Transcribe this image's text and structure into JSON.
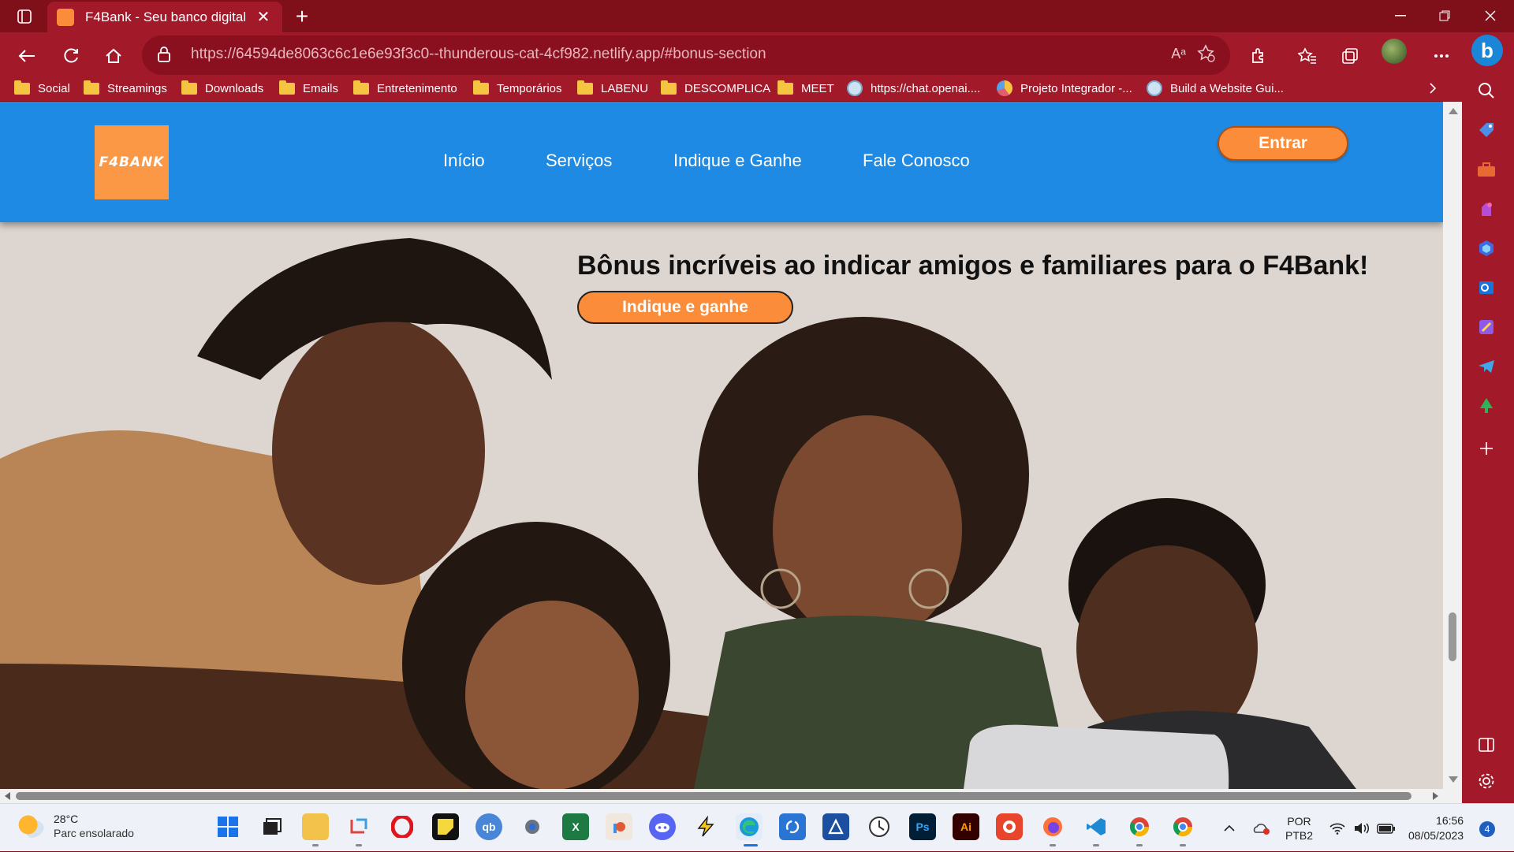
{
  "browser": {
    "tab_title": "F4Bank - Seu banco digital",
    "url_host": "https://64594de8063c6c1e6e93f3c0--thunderous-cat-4cf982.netlify.app",
    "url_path": "/#bonus-section",
    "read_aloud_label": "Aᵃ",
    "bookmarks": [
      {
        "label": "Social",
        "icon": "folder-icon"
      },
      {
        "label": "Streamings",
        "icon": "folder-icon"
      },
      {
        "label": "Downloads",
        "icon": "folder-icon"
      },
      {
        "label": "Emails",
        "icon": "folder-icon"
      },
      {
        "label": "Entretenimento",
        "icon": "folder-icon"
      },
      {
        "label": "Temporários",
        "icon": "folder-icon"
      },
      {
        "label": "LABENU",
        "icon": "folder-icon"
      },
      {
        "label": "DESCOMPLICA",
        "icon": "folder-icon"
      },
      {
        "label": "MEET",
        "icon": "folder-icon"
      },
      {
        "label": "https://chat.openai....",
        "icon": "globe-icon"
      },
      {
        "label": "Projeto Integrador -...",
        "icon": "chrome-icon"
      },
      {
        "label": "Build a Website Gui...",
        "icon": "globe-icon"
      }
    ],
    "accent_color": "#a2192a"
  },
  "site": {
    "logo_text": "F4BANK",
    "nav": [
      "Início",
      "Serviços",
      "Indique e Ganhe",
      "Fale Conosco"
    ],
    "login_button": "Entrar",
    "header_color": "#1f8ae3",
    "button_color": "#fb8c3a"
  },
  "hero": {
    "title": "Bônus incríveis ao indicar amigos e familiares para o F4Bank!",
    "cta": "Indique e ganhe"
  },
  "taskbar": {
    "weather_temp": "28°C",
    "weather_desc": "Parc ensolarado",
    "lang_top": "POR",
    "lang_bottom": "PTB2",
    "time": "16:56",
    "date": "08/05/2023",
    "notification_count": "4",
    "apps": [
      "start-icon",
      "file-explorer-icon",
      "snipping-tool-icon",
      "opera-icon",
      "sticky-notes-icon",
      "qbittorrent-icon",
      "settings-icon",
      "excel-icon",
      "paint-icon",
      "discord-icon",
      "power-automate-icon",
      "edge-icon",
      "sync-icon",
      "azure-data-studio-icon",
      "clock-icon",
      "photoshop-icon",
      "illustrator-icon",
      "screenrec-icon",
      "firefox-icon",
      "vscode-icon",
      "chrome-icon",
      "chrome-profile-icon"
    ]
  }
}
